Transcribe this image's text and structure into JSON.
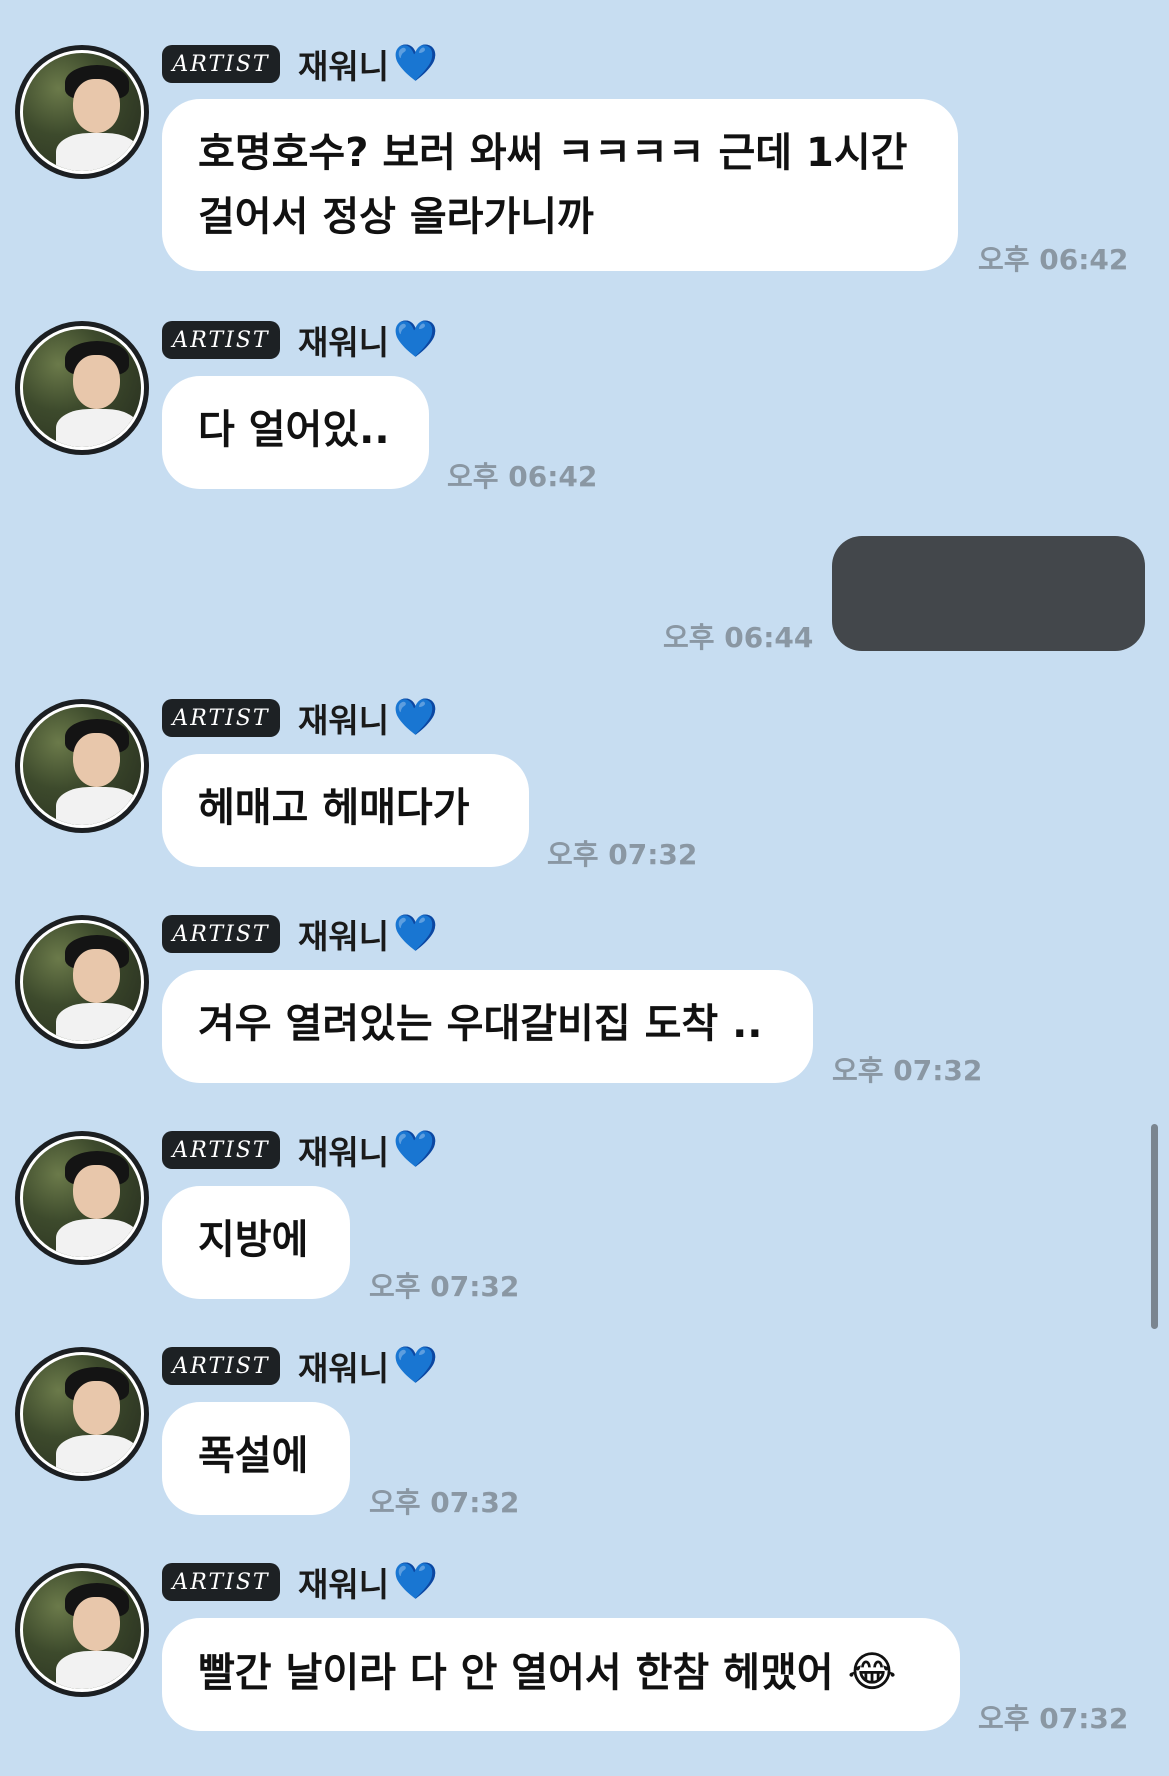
{
  "sender": {
    "badge": "ARTIST",
    "name": "재워니"
  },
  "messages": [
    {
      "lines": [
        "호명호수? 보러 와써 ㅋㅋㅋㅋ 근데 1시간",
        "걸어서 정상 올라가니까"
      ],
      "time": "오후 06:42"
    },
    {
      "lines": [
        "다 얼어있.."
      ],
      "time": "오후 06:42"
    },
    {
      "lines": [
        "헤매고 헤매다가"
      ],
      "time": "오후 07:32"
    },
    {
      "lines": [
        "겨우 열려있는 우대갈비집 도착 .."
      ],
      "time": "오후 07:32"
    },
    {
      "lines": [
        "지방에"
      ],
      "time": "오후 07:32"
    },
    {
      "lines": [
        "폭설에"
      ],
      "time": "오후 07:32"
    },
    {
      "lines": [
        "빨간 날이라 다 안 열어서 한참 헤맸어"
      ],
      "emoji": "😂",
      "time": "오후 07:32"
    }
  ],
  "sent_message": {
    "time": "오후 06:44"
  },
  "colors": {
    "background": "#c7ddf1",
    "bubble": "#ffffff",
    "badge": "#1d2124",
    "heart": "#5ec5ee",
    "sent_bubble": "#43474b"
  },
  "icons": {
    "heart": "light-blue-heart-icon",
    "emoji": "face-with-tears-of-joy"
  }
}
